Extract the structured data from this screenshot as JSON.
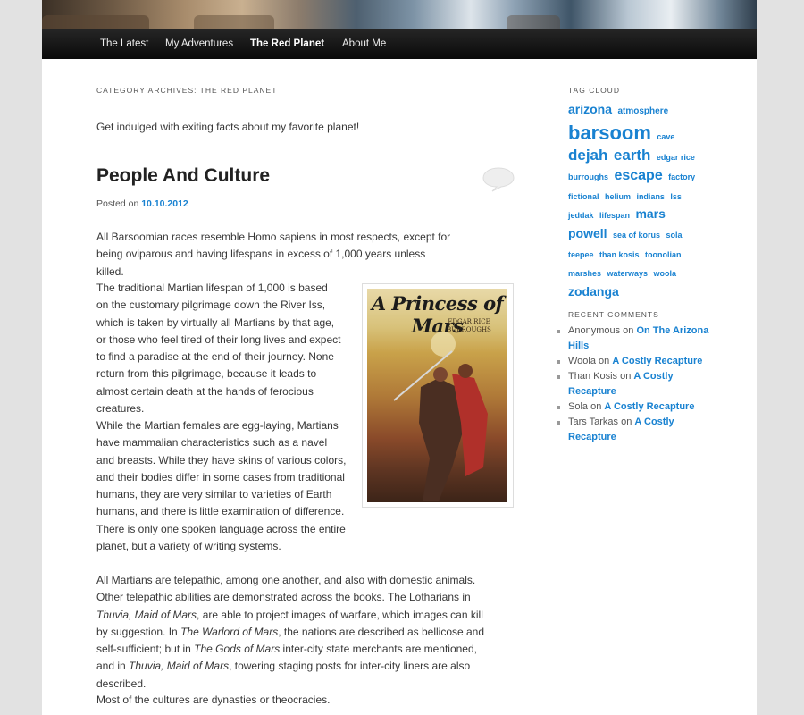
{
  "nav": {
    "items": [
      "The Latest",
      "My Adventures",
      "The Red Planet",
      "About Me"
    ]
  },
  "archive": {
    "title": "Category Archives: The Red Planet",
    "intro": "Get indulged with exiting facts about my favorite planet!"
  },
  "post": {
    "title": "People And Culture",
    "posted_on": "Posted on",
    "date": "10.10.2012",
    "comment_icon": "speech-bubble-icon",
    "p1": "All Barsoomian races resemble Homo sapiens in most respects, except for being oviparous and having lifespans in excess of 1,000 years unless killed.",
    "p2": "The traditional Martian lifespan of 1,000 is based on the customary pilgrimage down the River Iss, which is taken by virtually all Martians by that age, or those who feel tired of their long lives and expect to find a paradise at the end of their journey. None return from this pilgrimage, because it leads to almost certain death at the hands of ferocious creatures.",
    "p3": "While the Martian females are egg-laying, Martians have mammalian characteristics such as a navel and breasts. While they have skins of various colors, and their bodies differ in some cases from traditional humans, they are very similar to varieties of Earth humans, and there is little examination of difference. There is only one spoken language across the entire planet, but a variety of writing systems.",
    "p4": {
      "a": "All Martians are telepathic, among one another, and also with domestic animals. Other telepathic abilities are demonstrated across the books. The Lotharians in ",
      "b": "Thuvia, Maid of Mars",
      "c": ", are able to project images of warfare, which images can kill by suggestion.  In ",
      "d": "The Warlord of Mars",
      "e": ", the nations are described as bellicose and self-sufficient; but in ",
      "f": "The Gods of Mars",
      "g": " inter-city state merchants are mentioned, and in ",
      "h": "Thuvia, Maid of Mars",
      "i": ", towering staging posts for inter-city liners are also described."
    },
    "p5": "Most of the cultures are dynasties or theocracies.",
    "book": {
      "title": "A Princess of Mars",
      "author": "EDGAR RICE BURROUGHS"
    }
  },
  "sidebar": {
    "tag_cloud_title": "Tag Cloud",
    "tags": [
      {
        "name": "arizona",
        "size": 14
      },
      {
        "name": "atmosphere",
        "size": 10
      },
      {
        "name": "barsoom",
        "size": 22
      },
      {
        "name": "cave",
        "size": 9
      },
      {
        "name": "dejah",
        "size": 17
      },
      {
        "name": "earth",
        "size": 17
      },
      {
        "name": "edgar rice burroughs",
        "size": 9
      },
      {
        "name": "escape",
        "size": 16
      },
      {
        "name": "factory",
        "size": 9
      },
      {
        "name": "fictional",
        "size": 9
      },
      {
        "name": "helium",
        "size": 9
      },
      {
        "name": "indians",
        "size": 9
      },
      {
        "name": "Iss",
        "size": 9
      },
      {
        "name": "jeddak",
        "size": 9
      },
      {
        "name": "lifespan",
        "size": 9
      },
      {
        "name": "mars",
        "size": 14
      },
      {
        "name": "powell",
        "size": 14
      },
      {
        "name": "sea of korus",
        "size": 9
      },
      {
        "name": "sola",
        "size": 9
      },
      {
        "name": "teepee",
        "size": 9
      },
      {
        "name": "than kosis",
        "size": 9
      },
      {
        "name": "toonolian marshes",
        "size": 9
      },
      {
        "name": "waterways",
        "size": 9
      },
      {
        "name": "woola",
        "size": 9
      },
      {
        "name": "zodanga",
        "size": 14
      }
    ],
    "recent_comments_title": "Recent Comments",
    "comments": [
      {
        "author": "Anonymous",
        "on": "on",
        "post": "On The Arizona Hills"
      },
      {
        "author": "Woola",
        "on": "on",
        "post": "A Costly Recapture"
      },
      {
        "author": "Than Kosis",
        "on": "on",
        "post": "A Costly Recapture"
      },
      {
        "author": "Sola",
        "on": "on",
        "post": "A Costly Recapture"
      },
      {
        "author": "Tars Tarkas",
        "on": "on",
        "post": "A Costly Recapture"
      }
    ]
  }
}
